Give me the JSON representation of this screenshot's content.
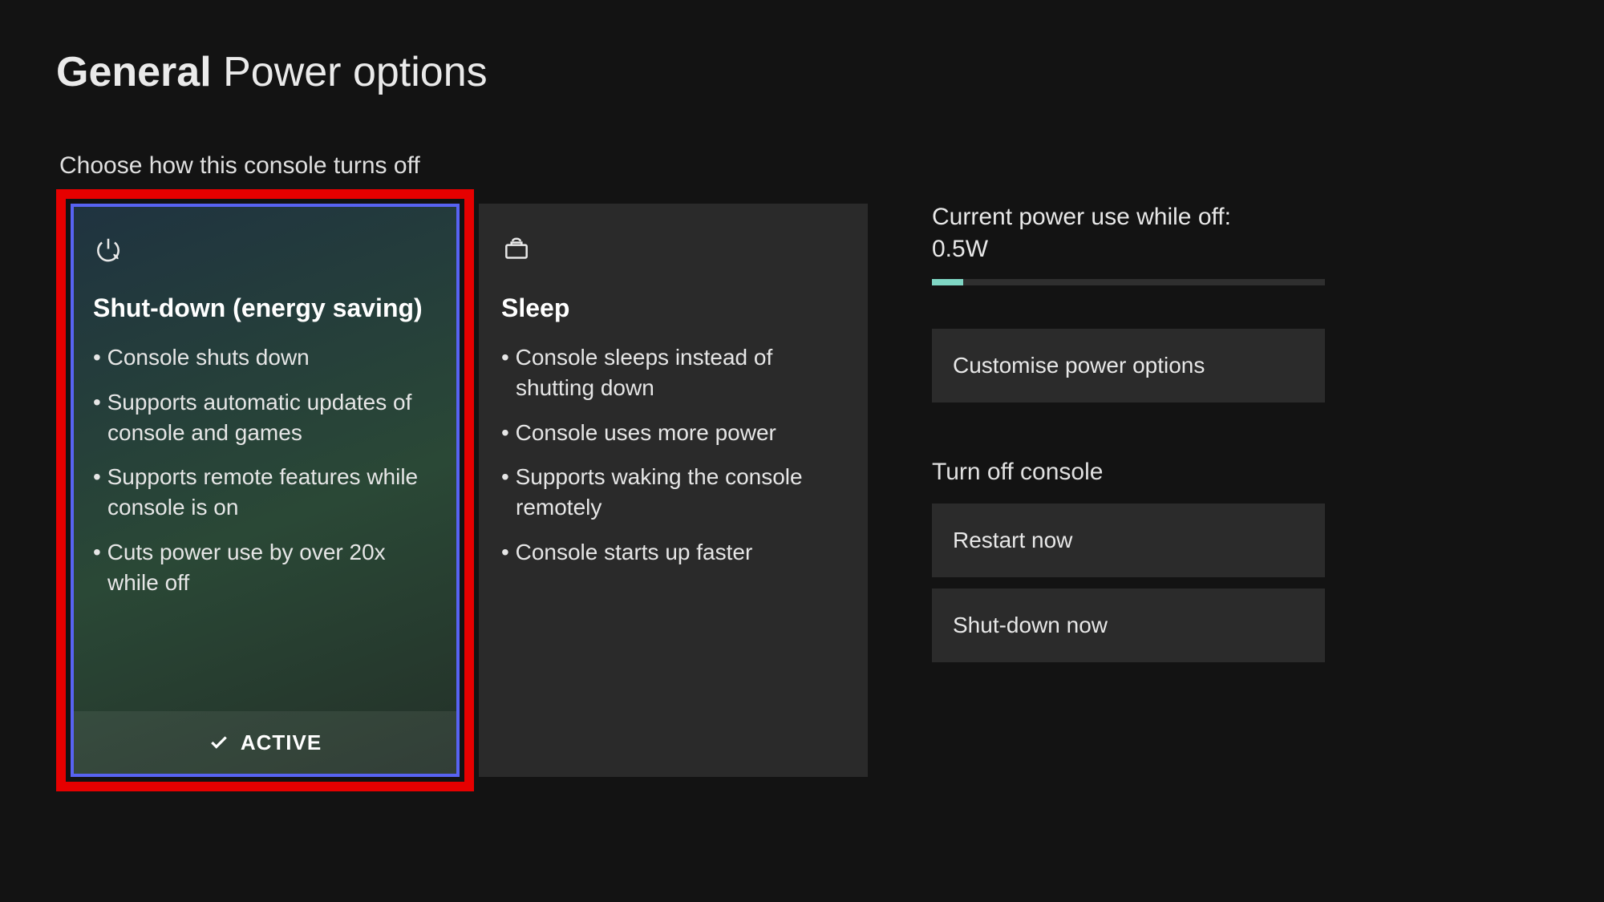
{
  "header": {
    "category": "General",
    "title": "Power options"
  },
  "section_heading": "Choose how this console turns off",
  "cards": {
    "shutdown": {
      "title": "Shut-down (energy saving)",
      "bullets": [
        "Console shuts down",
        "Supports automatic updates of console and games",
        "Supports remote features while console is on",
        "Cuts power use by over 20x while off"
      ],
      "active_label": "ACTIVE"
    },
    "sleep": {
      "title": "Sleep",
      "bullets": [
        "Console sleeps instead of shutting down",
        "Console uses more power",
        "Supports waking the console remotely",
        "Console starts up faster"
      ]
    }
  },
  "power_use": {
    "label": "Current power use while off:",
    "value": "0.5W",
    "fill_percent": 8
  },
  "buttons": {
    "customise": "Customise power options",
    "turn_off_label": "Turn off console",
    "restart": "Restart now",
    "shutdown_now": "Shut-down now"
  }
}
